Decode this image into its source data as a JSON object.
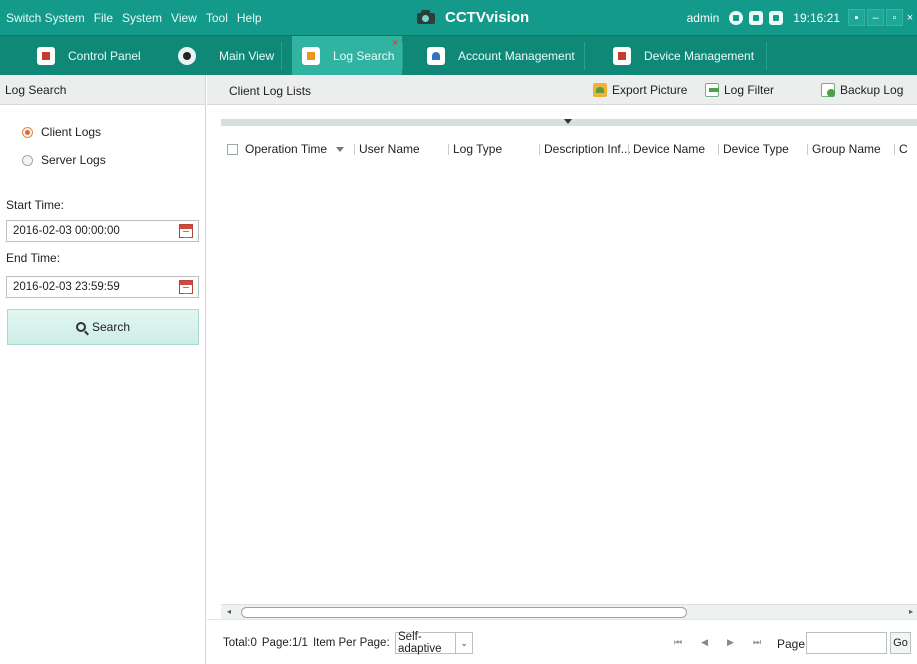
{
  "menu": [
    "Switch System",
    "File",
    "System",
    "View",
    "Tool",
    "Help"
  ],
  "brand": "CCTVvision",
  "status": {
    "user": "admin",
    "time": "19:16:21"
  },
  "window_controls": {
    "minimize": "–",
    "maximize": "▫",
    "close": "×"
  },
  "tabs": [
    {
      "label": "Control Panel",
      "active": false
    },
    {
      "label": "Main View",
      "active": false
    },
    {
      "label": "Log Search",
      "active": true,
      "close": "×"
    },
    {
      "label": "Account Management",
      "active": false
    },
    {
      "label": "Device Management",
      "active": false
    }
  ],
  "left_panel": {
    "title": "Log Search",
    "options": [
      "Client Logs",
      "Server Logs"
    ],
    "selected": "Client Logs",
    "start_label": "Start Time:",
    "start_value": "2016-02-03 00:00:00",
    "end_label": "End Time:",
    "end_value": "2016-02-03 23:59:59",
    "search_label": "Search"
  },
  "main": {
    "title": "Client Log Lists",
    "toolbar": {
      "export": "Export Picture",
      "filter": "Log Filter",
      "backup": "Backup Log"
    },
    "columns": [
      "Operation Time",
      "User Name",
      "Log Type",
      "Description Inf...",
      "Device Name",
      "Device Type",
      "Group Name",
      "C"
    ]
  },
  "footer": {
    "total": "Total:0",
    "page": "Page:1/1",
    "ipp_label": "Item Per Page:",
    "ipp_value": "Self-adaptive",
    "pager": [
      "⏮",
      "◀",
      "▶",
      "⏭"
    ],
    "page_label": "Page",
    "go": "Go"
  },
  "colors": {
    "titlebar": "#149a8a",
    "tabbar": "#0f8878",
    "active_tab": "#31b3a2"
  }
}
